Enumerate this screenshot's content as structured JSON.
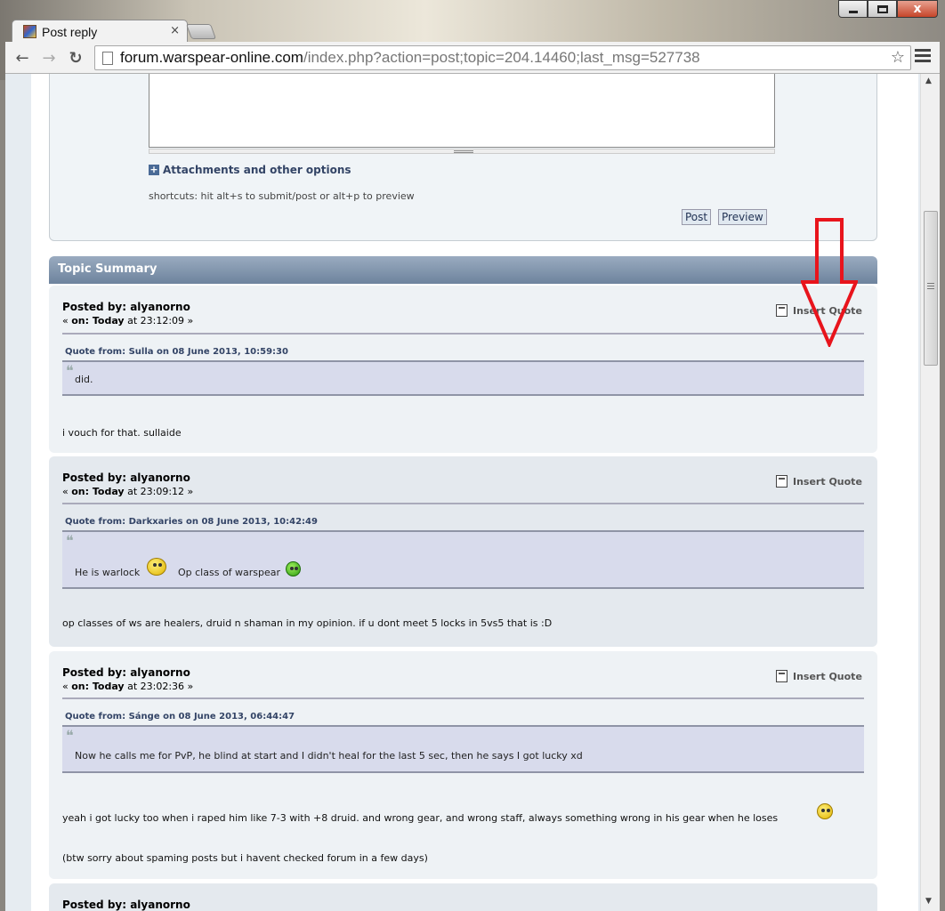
{
  "window": {
    "tab_title": "Post reply",
    "tab_close": "×",
    "close_label": "x"
  },
  "toolbar": {
    "back": "←",
    "forward": "→",
    "reload": "↻",
    "url_host": "forum.warspear-online.com",
    "url_path": "/index.php?action=post;topic=204.14460;last_msg=527738",
    "star": "☆"
  },
  "reply_form": {
    "attachments_label": "Attachments and other options",
    "shortcuts_text": "shortcuts: hit alt+s to submit/post or alt+p to preview",
    "post_button": "Post",
    "preview_button": "Preview"
  },
  "topic_summary": {
    "title": "Topic Summary",
    "insert_quote_label": "Insert Quote",
    "posts": [
      {
        "posted_by": "Posted by: alyanorno",
        "date_prefix": "« ",
        "date_on": "on: Today",
        "date_time": " at 23:12:09 »",
        "quote_header": "Quote from: Sulla on 08 June 2013, 10:59:30",
        "quote_text": "did.",
        "body": [
          "i vouch for that. sullaide"
        ]
      },
      {
        "posted_by": "Posted by: alyanorno",
        "date_prefix": "« ",
        "date_on": "on: Today",
        "date_time": " at 23:09:12 »",
        "quote_header": "Quote from: Darkxaries on 08 June 2013, 10:42:49",
        "quote_text_a": "He is warlock",
        "quote_text_b": "Op class of warspear",
        "body": [
          "op classes of ws are healers, druid n shaman in my opinion. if u dont meet 5 locks in 5vs5  that is :D"
        ]
      },
      {
        "posted_by": "Posted by: alyanorno",
        "date_prefix": "« ",
        "date_on": "on: Today",
        "date_time": " at 23:02:36 »",
        "quote_header": "Quote from: Sánge on 08 June 2013, 06:44:47",
        "quote_text": "Now he calls me for PvP, he blind at start and I didn't heal for the last 5 sec, then he says I got lucky xd",
        "body": [
          "yeah i got lucky too when i raped him like 7-3 with +8 druid. and wrong gear, and wrong staff, always something wrong in his gear when he loses",
          "(btw sorry about spaming posts but i havent checked forum in a few days)"
        ]
      },
      {
        "posted_by": "Posted by: alyanorno"
      }
    ]
  },
  "colors": {
    "annotation_arrow": "#e8141c",
    "summary_header": "#7a8fa8",
    "quote_bg": "#d8dbec"
  }
}
